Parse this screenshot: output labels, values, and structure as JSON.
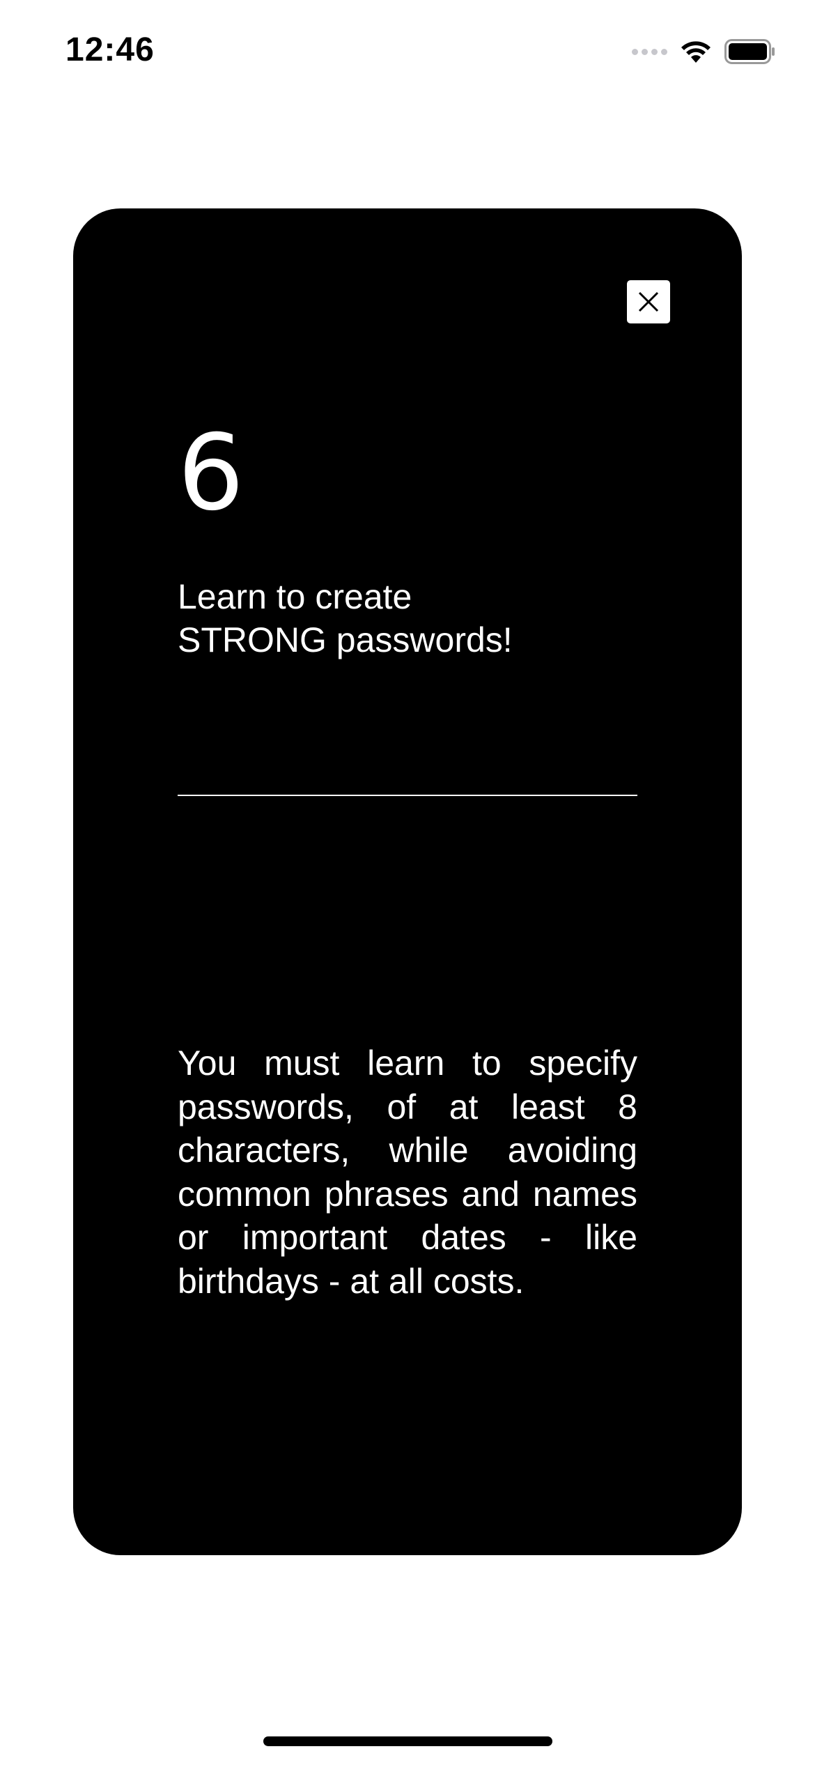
{
  "status_bar": {
    "time": "12:46",
    "icons": [
      "signal-icon",
      "wifi-icon",
      "battery-icon"
    ]
  },
  "card": {
    "close_icon": "close-icon",
    "step_number": "6",
    "headline": "Learn to create\nSTRONG passwords!",
    "body": "You must learn to specify passwords, of at least 8 characters, while avoiding common phrases and names or important dates - like birthdays - at all costs."
  },
  "colors": {
    "card_background": "#000000",
    "card_text": "#ffffff",
    "page_background": "#ffffff"
  }
}
